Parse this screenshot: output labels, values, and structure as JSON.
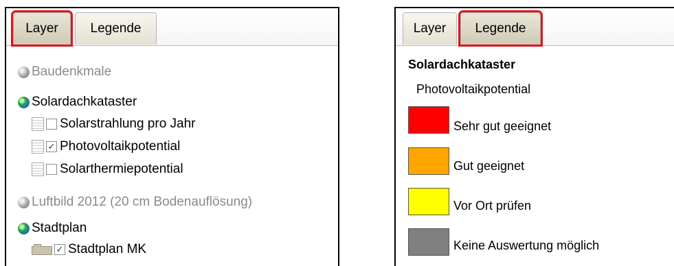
{
  "left_panel": {
    "tabs": [
      {
        "label": "Layer",
        "active": true,
        "highlighted": true
      },
      {
        "label": "Legende",
        "active": false,
        "highlighted": false
      }
    ],
    "layers": [
      {
        "label": "Baudenkmale",
        "enabled": false
      },
      {
        "label": "Solardachkataster",
        "enabled": true,
        "children": [
          {
            "label": "Solarstrahlung pro Jahr",
            "checked": false
          },
          {
            "label": "Photovoltaikpotential",
            "checked": true
          },
          {
            "label": "Solarthermiepotential",
            "checked": false
          }
        ]
      },
      {
        "label": "Luftbild 2012 (20 cm Bodenauflösung)",
        "enabled": false
      },
      {
        "label": "Stadtplan",
        "enabled": true,
        "children": [
          {
            "label": "Stadtplan MK",
            "checked": true
          }
        ]
      }
    ]
  },
  "right_panel": {
    "tabs": [
      {
        "label": "Layer",
        "active": false,
        "highlighted": false
      },
      {
        "label": "Legende",
        "active": true,
        "highlighted": true
      }
    ],
    "legend": {
      "title": "Solardachkataster",
      "subtitle": "Photovoltaikpotential",
      "items": [
        {
          "label": "Sehr gut geeignet",
          "color": "#ff0000"
        },
        {
          "label": "Gut geeignet",
          "color": "#ffa500"
        },
        {
          "label": "Vor Ort prüfen",
          "color": "#ffff00"
        },
        {
          "label": "Keine Auswertung möglich",
          "color": "#808080"
        }
      ]
    }
  },
  "colors": {
    "highlight": "#e0141e",
    "disabled_text": "#8a8a8a"
  },
  "checkmark": "✓"
}
